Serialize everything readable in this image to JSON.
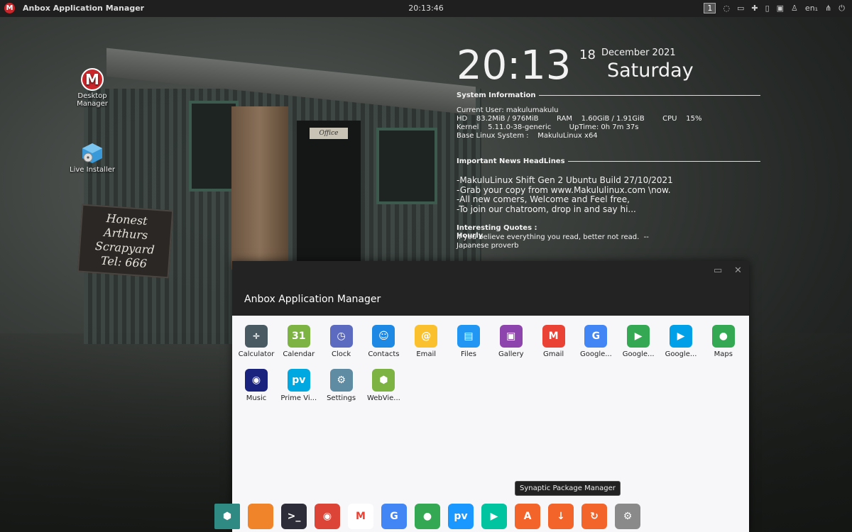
{
  "topbar": {
    "app_logo": "M",
    "window_title": "Anbox Application Manager",
    "clock": "20:13:46",
    "workspace": "1",
    "language": "en₁"
  },
  "desktop": {
    "icons": [
      {
        "label": "Desktop Manager",
        "icon": "makulu-logo-icon"
      },
      {
        "label": "Live Installer",
        "icon": "installer-disc-icon"
      }
    ]
  },
  "wallpaper": {
    "sign_lines": [
      "Honest",
      "Arthurs",
      "Scrapyard",
      "Tel: 666"
    ],
    "door_sign": "Office"
  },
  "conky": {
    "time": "20:13",
    "day": "18",
    "month_year": "December 2021",
    "weekday": "Saturday",
    "system_title": "System Information",
    "system_lines": [
      "Current User: makulumakulu",
      "HD    83.2MiB / 976MiB        RAM    1.60GiB / 1.91GiB        CPU    15%",
      "Kernel    5.11.0-38-generic        UpTime: 0h 7m 37s",
      "Base Linux System :    MakuluLinux x64"
    ],
    "news_title": "Important News HeadLines",
    "news_lines": [
      "-MakuluLinux Shift Gen 2 Ubuntu Build 27/10/2021",
      "-Grab your copy from www.Makululinux.com \\now.",
      "-All new comers, Welcome and Feel free,",
      "-To join our chatroom, drop in and say hi..."
    ],
    "quotes_title": "Interesting Quotes : Hourly",
    "quote_lines": [
      "If you believe everything you read, better not read.  --",
      "Japanese proverb"
    ]
  },
  "anbox": {
    "title": "Anbox Application Manager",
    "apps": [
      {
        "label": "Calculator",
        "icon": "calculator-icon",
        "color": "#4a5a63",
        "glyph": "÷"
      },
      {
        "label": "Calendar",
        "icon": "calendar-icon",
        "color": "#7cb342",
        "glyph": "31"
      },
      {
        "label": "Clock",
        "icon": "clock-icon",
        "color": "#5c6bc0",
        "glyph": "◷"
      },
      {
        "label": "Contacts",
        "icon": "contacts-icon",
        "color": "#1e88e5",
        "glyph": "☺"
      },
      {
        "label": "Email",
        "icon": "email-icon",
        "color": "#fbc02d",
        "glyph": "@"
      },
      {
        "label": "Files",
        "icon": "files-icon",
        "color": "#2196f3",
        "glyph": "▤"
      },
      {
        "label": "Gallery",
        "icon": "gallery-icon",
        "color": "#8e44ad",
        "glyph": "▣"
      },
      {
        "label": "Gmail",
        "icon": "gmail-icon",
        "color": "#ea4335",
        "glyph": "M"
      },
      {
        "label": "Google...",
        "icon": "google-news-icon",
        "color": "#4285f4",
        "glyph": "G"
      },
      {
        "label": "Google...",
        "icon": "google-play-games-icon",
        "color": "#34a853",
        "glyph": "▶"
      },
      {
        "label": "Google...",
        "icon": "google-play-store-icon",
        "color": "#00a0e9",
        "glyph": "▶"
      },
      {
        "label": "Maps",
        "icon": "maps-icon",
        "color": "#34a853",
        "glyph": "●"
      },
      {
        "label": "Music",
        "icon": "music-icon",
        "color": "#1a237e",
        "glyph": "◉"
      },
      {
        "label": "Prime Vi...",
        "icon": "prime-video-icon",
        "color": "#00a8e1",
        "glyph": "pv"
      },
      {
        "label": "Settings",
        "icon": "settings-icon",
        "color": "#5f8ba3",
        "glyph": "⚙"
      },
      {
        "label": "WebVie...",
        "icon": "webview-icon",
        "color": "#7cb342",
        "glyph": "⬢"
      }
    ]
  },
  "dock": {
    "tooltip": "Synaptic Package Manager",
    "items": [
      {
        "icon": "android-icon",
        "color": "#2f8a84",
        "glyph": "⬢"
      },
      {
        "icon": "folder-icon",
        "color": "#f0842a",
        "glyph": ""
      },
      {
        "icon": "terminal-icon",
        "color": "#2d2d3a",
        "glyph": ">_"
      },
      {
        "icon": "chrome-icon",
        "color": "#db4437",
        "glyph": "◉"
      },
      {
        "icon": "gmail-icon",
        "color": "#ffffff",
        "glyph": "M"
      },
      {
        "icon": "google-news-icon",
        "color": "#4285f4",
        "glyph": "G"
      },
      {
        "icon": "maps-icon",
        "color": "#34a853",
        "glyph": "●"
      },
      {
        "icon": "prime-video-icon",
        "color": "#1a98ff",
        "glyph": "pv"
      },
      {
        "icon": "play-store-icon",
        "color": "#00c4a0",
        "glyph": "▶"
      },
      {
        "icon": "synaptic-icon",
        "color": "#f2642a",
        "glyph": "A"
      },
      {
        "icon": "software-updater-icon",
        "color": "#f2642a",
        "glyph": "↓"
      },
      {
        "icon": "update-refresh-icon",
        "color": "#f2642a",
        "glyph": "↻"
      },
      {
        "icon": "settings-gear-icon",
        "color": "#8a8a8a",
        "glyph": "⚙"
      }
    ]
  }
}
